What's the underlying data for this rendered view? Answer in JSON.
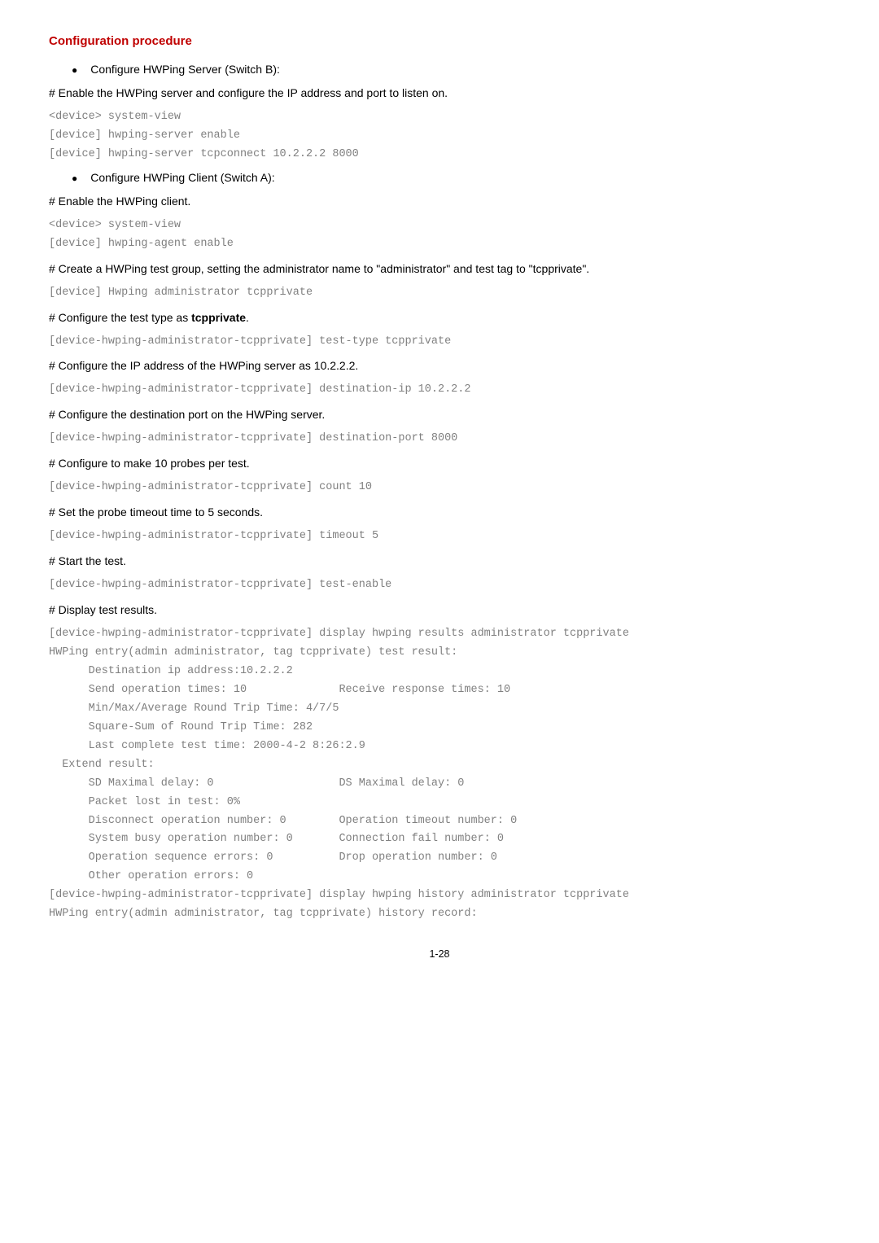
{
  "heading": "Configuration procedure",
  "bullets": {
    "server": "Configure HWPing Server (Switch B):",
    "client": "Configure HWPing Client (Switch A):"
  },
  "steps": {
    "s1": "# Enable the HWPing server and configure the IP address and port to listen on.",
    "s2": "# Enable the HWPing client.",
    "s3": "# Create a HWPing test group, setting the administrator name to \"administrator\" and test tag to \"tcpprivate\".",
    "s4_pre": "# Configure the test type as ",
    "s4_bold": "tcpprivate",
    "s4_post": ".",
    "s5": "# Configure the IP address of the HWPing server as 10.2.2.2.",
    "s6": "# Configure the destination port on the HWPing server.",
    "s7": "# Configure to make 10 probes per test.",
    "s8": "# Set the probe timeout time to 5 seconds.",
    "s9": "# Start the test.",
    "s10": "# Display test results."
  },
  "code": {
    "c1": "<device> system-view\n[device] hwping-server enable\n[device] hwping-server tcpconnect 10.2.2.2 8000",
    "c2": "<device> system-view\n[device] hwping-agent enable",
    "c3": "[device] Hwping administrator tcpprivate",
    "c4": "[device-hwping-administrator-tcpprivate] test-type tcpprivate",
    "c5": "[device-hwping-administrator-tcpprivate] destination-ip 10.2.2.2",
    "c6": "[device-hwping-administrator-tcpprivate] destination-port 8000",
    "c7": "[device-hwping-administrator-tcpprivate] count 10",
    "c8": "[device-hwping-administrator-tcpprivate] timeout 5",
    "c9": "[device-hwping-administrator-tcpprivate] test-enable",
    "c10": "[device-hwping-administrator-tcpprivate] display hwping results administrator tcpprivate\nHWPing entry(admin administrator, tag tcpprivate) test result:\n      Destination ip address:10.2.2.2\n      Send operation times: 10              Receive response times: 10\n      Min/Max/Average Round Trip Time: 4/7/5\n      Square-Sum of Round Trip Time: 282\n      Last complete test time: 2000-4-2 8:26:2.9\n  Extend result:\n      SD Maximal delay: 0                   DS Maximal delay: 0\n      Packet lost in test: 0%\n      Disconnect operation number: 0        Operation timeout number: 0\n      System busy operation number: 0       Connection fail number: 0\n      Operation sequence errors: 0          Drop operation number: 0\n      Other operation errors: 0\n[device-hwping-administrator-tcpprivate] display hwping history administrator tcpprivate\nHWPing entry(admin administrator, tag tcpprivate) history record:"
  },
  "pagenum": "1-28"
}
